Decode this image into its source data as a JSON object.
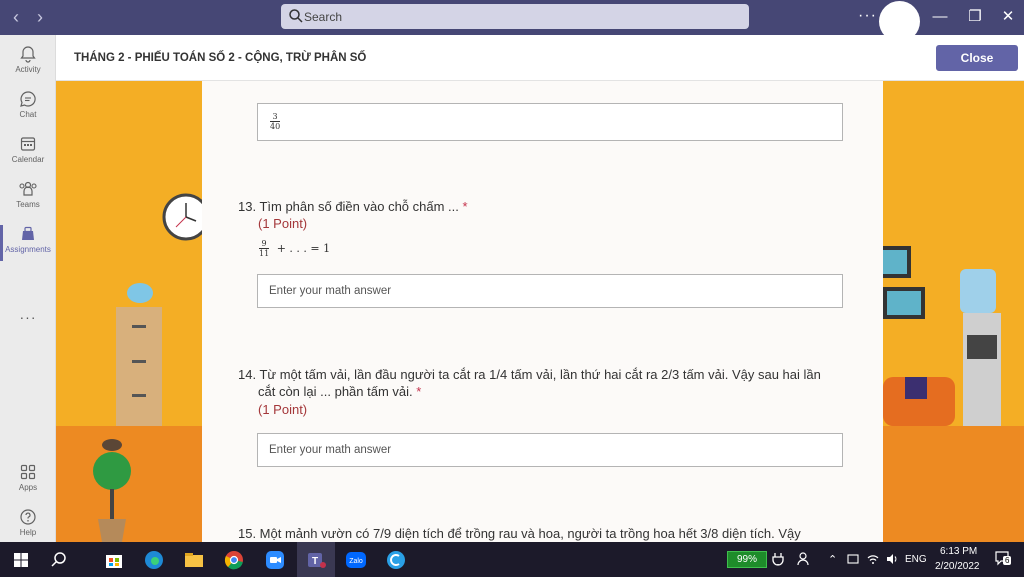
{
  "titlebar": {
    "back_icon": "chevron-left-icon",
    "forward_icon": "chevron-right-icon",
    "search_placeholder": "Search",
    "more": "···",
    "minimize": "—",
    "maximize": "❐",
    "close": "✕"
  },
  "rail": {
    "items": [
      {
        "label": "Activity",
        "icon": "bell-icon"
      },
      {
        "label": "Chat",
        "icon": "chat-icon"
      },
      {
        "label": "Calendar",
        "icon": "calendar-icon"
      },
      {
        "label": "Teams",
        "icon": "teams-icon"
      },
      {
        "label": "Assignments",
        "icon": "assignments-icon",
        "active": true
      },
      {
        "label": "Apps",
        "icon": "apps-icon"
      },
      {
        "label": "Help",
        "icon": "help-icon"
      }
    ],
    "more": "···"
  },
  "header": {
    "title": "THÁNG 2 - PHIẾU TOÁN SỐ 2 - CỘNG, TRỪ PHÂN SỐ",
    "close_label": "Close"
  },
  "form": {
    "prev_answer": {
      "numerator": "3",
      "denominator": "40"
    },
    "q13": {
      "title": "13. Tìm phân số điền vào chỗ chấm ...",
      "required": "*",
      "points": "(1 Point)",
      "expr_numerator": "9",
      "expr_denominator": "11",
      "expr_rest": "+  . . . =  1",
      "placeholder": "Enter your math answer"
    },
    "q14": {
      "title_line1": "14. Từ một tấm vải, lần đầu người ta cắt ra 1/4 tấm vải, lần thứ hai cắt ra 2/3 tấm vải. Vậy sau hai lần",
      "title_line2": "cắt còn lại ... phần tấm vải.",
      "required": "*",
      "points": "(1 Point)",
      "placeholder": "Enter your math answer"
    },
    "q15": {
      "title": "15. Một mảnh vườn có 7/9 diện tích để trồng rau và hoa, người ta trồng hoa hết 3/8 diện tích. Vậy"
    }
  },
  "taskbar": {
    "battery": "99%",
    "lang": "ENG",
    "time": "6:13 PM",
    "date": "2/20/2022",
    "notifications": "6"
  },
  "colors": {
    "titlebar": "#464775",
    "accent": "#6264a7",
    "wall": "#f4ae25",
    "floor": "#ed8a22",
    "taskbar": "#1c1a2a"
  }
}
